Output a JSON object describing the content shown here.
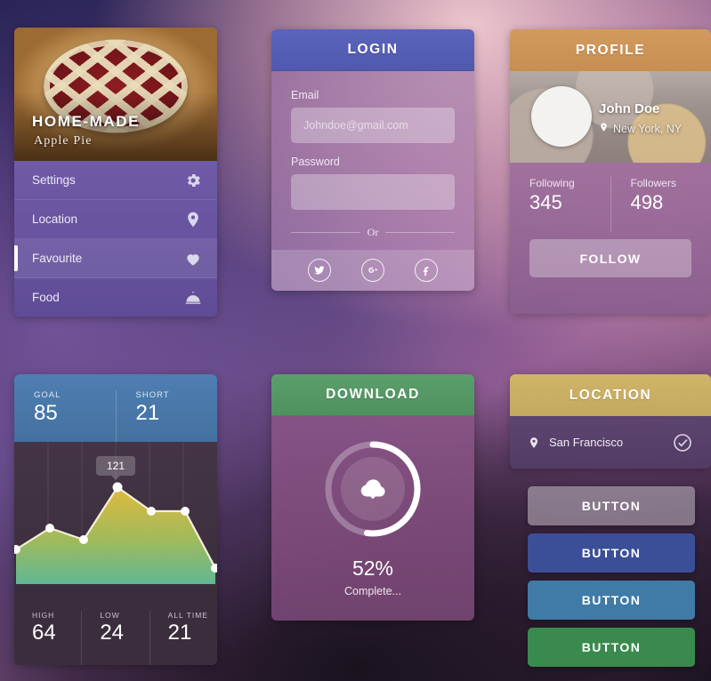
{
  "menu_card": {
    "hero": {
      "title": "HOME-MADE",
      "subtitle": "Apple Pie",
      "image": "apple-pie-photo"
    },
    "items": [
      {
        "label": "Settings",
        "icon": "gear-icon",
        "active": false
      },
      {
        "label": "Location",
        "icon": "map-pin-icon",
        "active": false
      },
      {
        "label": "Favourite",
        "icon": "heart-icon",
        "active": true
      },
      {
        "label": "Food",
        "icon": "food-dome-icon",
        "active": false
      }
    ]
  },
  "login_card": {
    "title": "LOGIN",
    "email_label": "Email",
    "email_placeholder": "Johndoe@gmail.com",
    "email_value": "",
    "password_label": "Password",
    "password_placeholder": "",
    "password_value": "",
    "or_text": "Or",
    "social": [
      {
        "name": "twitter-icon"
      },
      {
        "name": "google-plus-icon"
      },
      {
        "name": "facebook-icon"
      }
    ],
    "header_color": "#5560b8"
  },
  "profile_card": {
    "title": "PROFILE",
    "name": "John Doe",
    "location": "New York, NY",
    "stats": [
      {
        "label": "Following",
        "value": "345"
      },
      {
        "label": "Followers",
        "value": "498"
      }
    ],
    "follow_label": "FOLLOW",
    "header_color": "#d09858"
  },
  "chart_card": {
    "top_stats": [
      {
        "label": "GOAL",
        "value": "85"
      },
      {
        "label": "SHORT",
        "value": "21"
      }
    ],
    "bottom_stats": [
      {
        "label": "HIGH",
        "value": "64"
      },
      {
        "label": "LOW",
        "value": "24"
      },
      {
        "label": "ALL TIME",
        "value": "21"
      }
    ],
    "tooltip": "121",
    "header_color": "#4a7ab0"
  },
  "chart_data": {
    "type": "area",
    "title": "",
    "xlabel": "",
    "ylabel": "",
    "x": [
      0,
      1,
      2,
      3,
      4,
      5,
      6
    ],
    "values": [
      42,
      62,
      52,
      121,
      95,
      95,
      28
    ],
    "ylim": [
      0,
      135
    ],
    "grid": true,
    "annotations": [
      {
        "x": 3,
        "y": 121,
        "text": "121"
      }
    ],
    "legend": "none",
    "point_color": "#ffffff",
    "line_color": "#f2efd8",
    "fill_gradient": [
      "#e8c13c",
      "#6fc49a"
    ]
  },
  "download_card": {
    "title": "DOWNLOAD",
    "percent_label": "52%",
    "percent_value": 52,
    "status": "Complete...",
    "icon": "cloud-download-icon",
    "header_color": "#57a068"
  },
  "location_card": {
    "title": "LOCATION",
    "place": "San Francisco",
    "pin_icon": "map-pin-icon",
    "check_icon": "check-circle-icon",
    "header_color": "#c9ac61"
  },
  "buttons": [
    {
      "label": "BUTTON",
      "color": "#bdb1bd"
    },
    {
      "label": "BUTTON",
      "color": "#3b4f98"
    },
    {
      "label": "BUTTON",
      "color": "#3f7ba6"
    },
    {
      "label": "BUTTON",
      "color": "#3a8a4e"
    }
  ]
}
